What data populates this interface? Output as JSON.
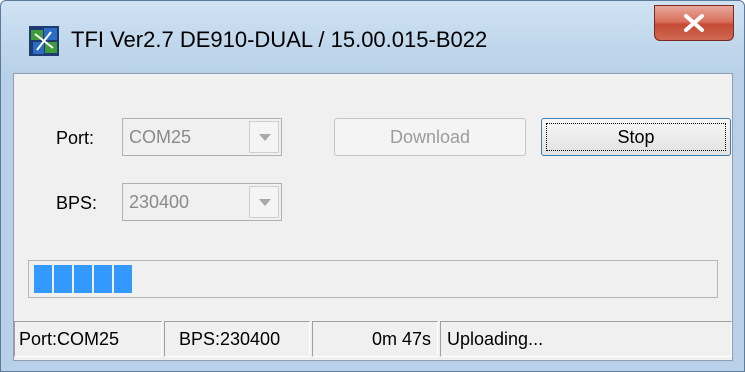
{
  "window": {
    "title": "TFI Ver2.7 DE910-DUAL / 15.00.015-B022",
    "icon": "app-icon",
    "close_icon": "close-icon"
  },
  "form": {
    "port_label": "Port:",
    "port_value": "COM25",
    "bps_label": "BPS:",
    "bps_value": "230400",
    "download_label": "Download",
    "stop_label": "Stop"
  },
  "progress": {
    "segments_filled": 5,
    "fill_color": "#3399ff"
  },
  "statusbar": {
    "port": "Port:COM25",
    "bps": "BPS:230400",
    "elapsed": "0m 47s",
    "status": "Uploading..."
  }
}
